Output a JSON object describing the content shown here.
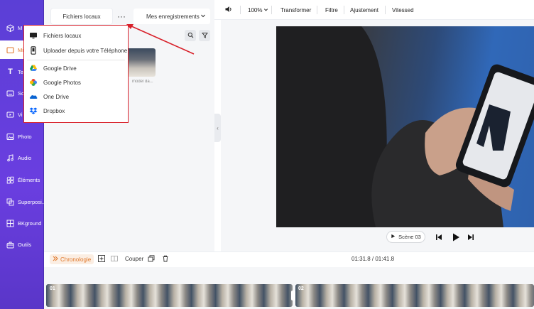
{
  "sidebar": {
    "items": [
      {
        "label": "M",
        "icon": "cube-icon"
      },
      {
        "label": "Mi",
        "icon": "folder-icon",
        "active": true
      },
      {
        "label": "Te",
        "icon": "text-icon"
      },
      {
        "label": "So",
        "icon": "subtitle-icon"
      },
      {
        "label": "Vi",
        "icon": "video-icon"
      },
      {
        "label": "Photo",
        "icon": "image-icon"
      },
      {
        "label": "Audio",
        "icon": "music-icon"
      },
      {
        "label": "Éléments",
        "icon": "elements-icon"
      },
      {
        "label": "Superposi...",
        "icon": "overlay-icon"
      },
      {
        "label": "BKground",
        "icon": "background-icon"
      },
      {
        "label": "Outils",
        "icon": "toolbox-icon"
      }
    ]
  },
  "media_panel": {
    "local_files_label": "Fichiers locaux",
    "more_label": "···",
    "recordings_label": "Mes enregistrements",
    "thumb_caption": "model da..."
  },
  "dropdown": {
    "items": [
      {
        "label": "Fichiers locaux",
        "icon": "monitor-icon"
      },
      {
        "label": "Uploader depuis votre Téléphone",
        "icon": "phone-icon"
      },
      {
        "label": "Google Drive",
        "icon": "google-drive-icon"
      },
      {
        "label": "Google Photos",
        "icon": "google-photos-icon"
      },
      {
        "label": "One Drive",
        "icon": "onedrive-icon"
      },
      {
        "label": "Dropbox",
        "icon": "dropbox-icon"
      }
    ],
    "highlight_color": "#d8202a"
  },
  "toolbar": {
    "zoom": "100%",
    "transform": "Transformer",
    "filter": "Filtre",
    "adjust": "Ajustement",
    "speed": "Vitessed"
  },
  "preview": {
    "scene_label": "Scène 03"
  },
  "timeline": {
    "chrono_label": "Chronologie",
    "cut_label": "Couper",
    "time": "01:31.8 / 01:41.8",
    "clips": [
      "01",
      "02"
    ]
  },
  "colors": {
    "sidebar": "#6a3ee0",
    "accent": "#e07a2e",
    "annotation": "#d8202a"
  }
}
